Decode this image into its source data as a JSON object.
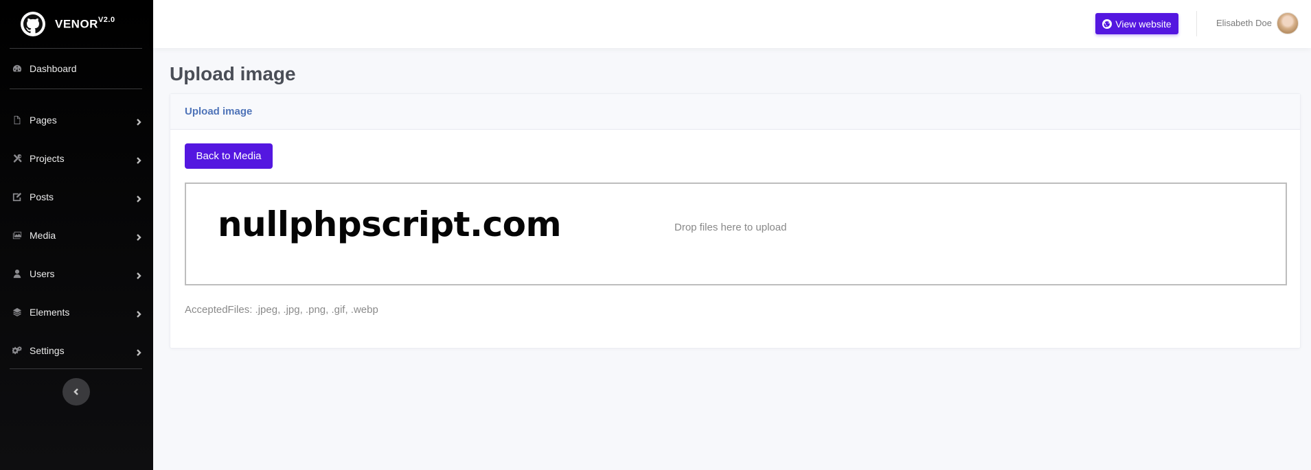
{
  "brand": {
    "name": "VENOR",
    "version": "V2.0"
  },
  "sidebar": {
    "dashboard": "Dashboard",
    "items": [
      {
        "label": "Pages",
        "icon": "file-icon"
      },
      {
        "label": "Projects",
        "icon": "tools-icon"
      },
      {
        "label": "Posts",
        "icon": "edit-icon"
      },
      {
        "label": "Media",
        "icon": "images-icon"
      },
      {
        "label": "Users",
        "icon": "user-icon"
      },
      {
        "label": "Elements",
        "icon": "layers-icon"
      },
      {
        "label": "Settings",
        "icon": "cogs-icon"
      }
    ]
  },
  "topbar": {
    "view_website": "View website",
    "user_name": "Elisabeth Doe"
  },
  "main": {
    "page_title": "Upload image",
    "card_title": "Upload image",
    "back_button": "Back to Media",
    "watermark": "nullphpscript.com",
    "drop_text": "Drop files here to upload",
    "accepted_files": "AcceptedFiles: .jpeg, .jpg, .png, .gif, .webp"
  },
  "colors": {
    "accent": "#5417e0",
    "sidebar_bg": "#000000",
    "card_title": "#4e73b8"
  }
}
